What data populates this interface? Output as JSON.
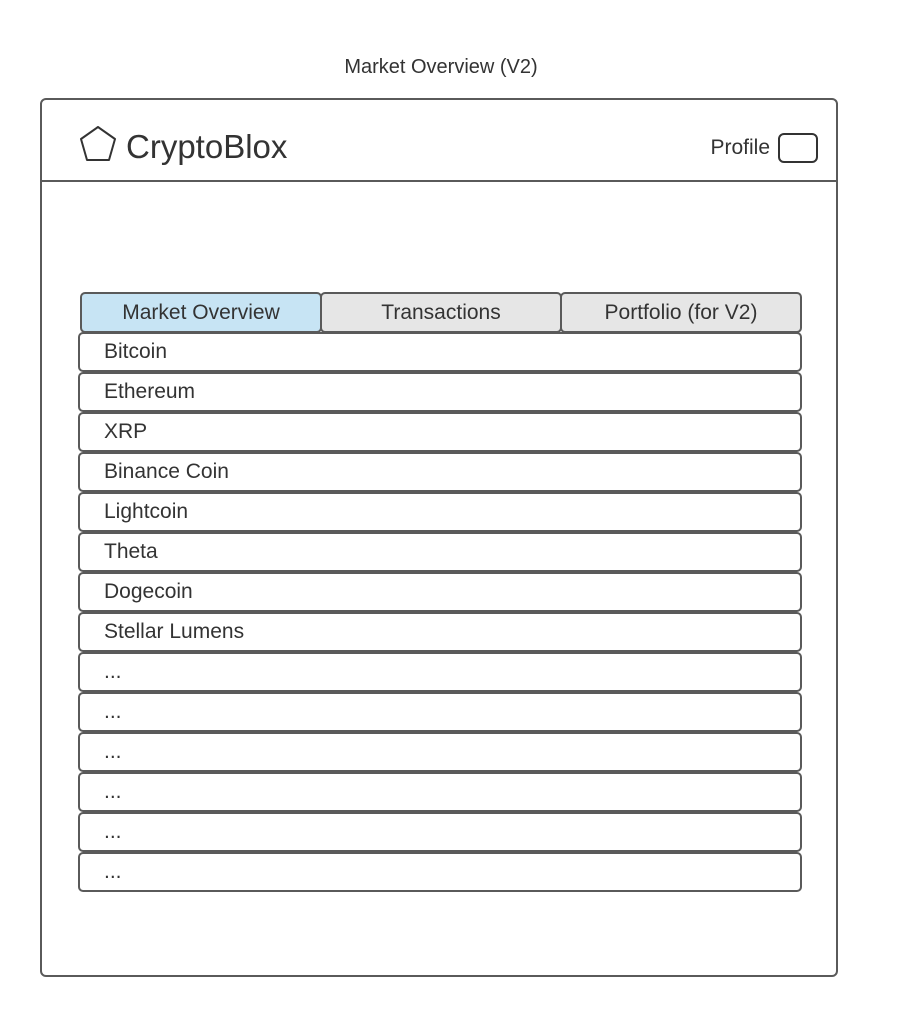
{
  "page_title": "Market Overview (V2)",
  "header": {
    "brand": "CryptoBlox",
    "profile_label": "Profile"
  },
  "tabs": [
    {
      "label": "Market Overview",
      "active": true
    },
    {
      "label": "Transactions",
      "active": false
    },
    {
      "label": "Portfolio (for V2)",
      "active": false
    }
  ],
  "coins": [
    "Bitcoin",
    "Ethereum",
    "XRP",
    "Binance Coin",
    "Lightcoin",
    "Theta",
    "Dogecoin",
    "Stellar Lumens",
    "...",
    "...",
    "...",
    "...",
    "...",
    "..."
  ],
  "colors": {
    "active_tab": "#c7e4f4",
    "inactive_tab": "#e6e6e6",
    "border": "#5a5a5a",
    "text": "#333333"
  },
  "icons": {
    "logo": "pentagon-logo-icon",
    "profile": "profile-avatar-icon"
  }
}
